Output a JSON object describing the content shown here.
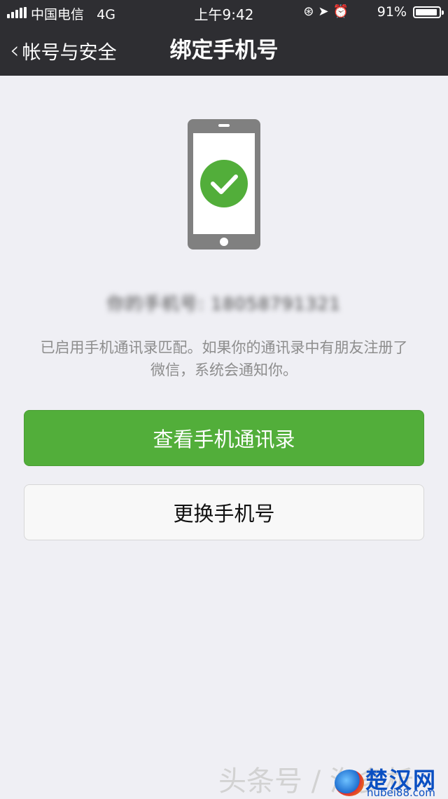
{
  "status_bar": {
    "carrier": "中国电信",
    "network": "4G",
    "time": "上午9:42",
    "battery_percent": "91%",
    "battery_level": 0.91
  },
  "nav": {
    "back_label": "帐号与安全",
    "title": "绑定手机号"
  },
  "phone_number_label": "你的手机号: 18058791321",
  "description_line1": "已启用手机通讯录匹配。如果你的通讯录中有朋友注册了",
  "description_line2": "微信，系统会通知你。",
  "buttons": {
    "view_contacts": "查看手机通讯录",
    "change_number": "更换手机号"
  },
  "watermark": {
    "text": "头条号 / 淘多析",
    "logo_main": "楚汉网",
    "logo_sub": "hubei88.com"
  },
  "colors": {
    "nav_bg": "#2e2e32",
    "page_bg": "#efeff4",
    "accent_green": "#52ae3a"
  },
  "icons": [
    "signal-icon",
    "lock-rotation-icon",
    "location-icon",
    "alarm-icon",
    "battery-icon",
    "back-chevron-icon",
    "phone-check-icon"
  ]
}
